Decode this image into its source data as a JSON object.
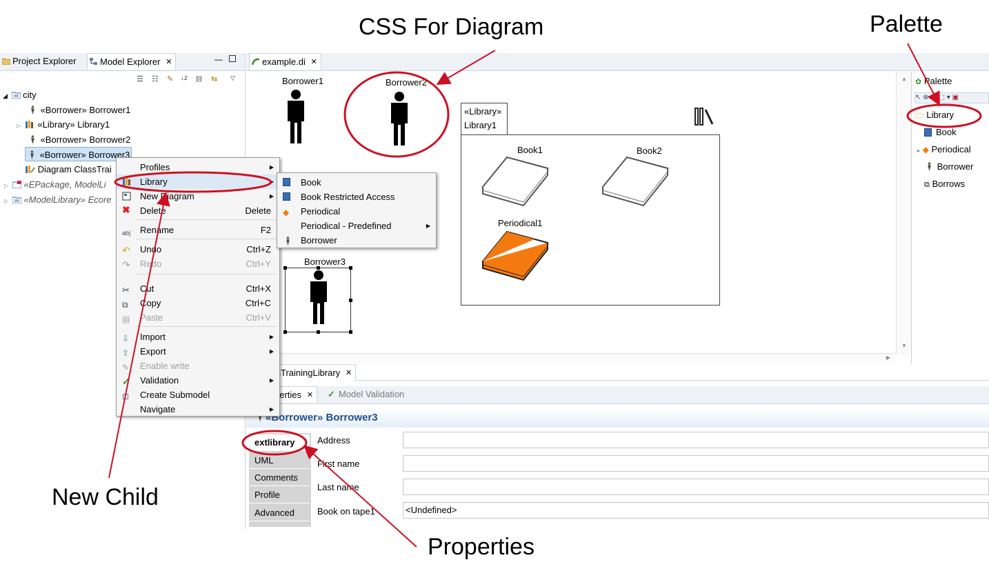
{
  "callouts": {
    "css_for_diagram": "CSS For Diagram",
    "palette": "Palette",
    "new_child": "New Child",
    "properties": "Properties"
  },
  "left_panel": {
    "tabs": [
      {
        "label": "Project Explorer"
      },
      {
        "label": "Model Explorer"
      }
    ],
    "tree": [
      {
        "label": "city"
      },
      {
        "label": "«Borrower» Borrower1"
      },
      {
        "label": "«Library» Library1"
      },
      {
        "label": "«Borrower» Borrower2"
      },
      {
        "label": "«Borrower» Borrower3"
      },
      {
        "label": "Diagram ClassTrai"
      },
      {
        "label": "«EPackage, ModelLi"
      },
      {
        "label": "«ModelLibrary» Ecore"
      }
    ]
  },
  "context_menu": {
    "items": [
      {
        "label": "Profiles",
        "shortcut": ""
      },
      {
        "label": "Library",
        "shortcut": ""
      },
      {
        "label": "New Diagram",
        "shortcut": ""
      },
      {
        "label": "Delete",
        "shortcut": "Delete"
      },
      {
        "label": "Rename",
        "shortcut": "F2"
      },
      {
        "label": "Undo",
        "shortcut": "Ctrl+Z"
      },
      {
        "label": "Redo",
        "shortcut": "Ctrl+Y"
      },
      {
        "label": "Cut",
        "shortcut": "Ctrl+X"
      },
      {
        "label": "Copy",
        "shortcut": "Ctrl+C"
      },
      {
        "label": "Paste",
        "shortcut": "Ctrl+V"
      },
      {
        "label": "Import",
        "shortcut": ""
      },
      {
        "label": "Export",
        "shortcut": ""
      },
      {
        "label": "Enable write",
        "shortcut": ""
      },
      {
        "label": "Validation",
        "shortcut": ""
      },
      {
        "label": "Create Submodel",
        "shortcut": ""
      },
      {
        "label": "Navigate",
        "shortcut": ""
      }
    ]
  },
  "submenu": {
    "items": [
      {
        "label": "Book"
      },
      {
        "label": "Book Restricted Access"
      },
      {
        "label": "Periodical"
      },
      {
        "label": "Periodical - Predefined"
      },
      {
        "label": "Borrower"
      }
    ]
  },
  "editor": {
    "tab_label": "example.di",
    "diagram": {
      "borrower1": "Borrower1",
      "borrower2": "Borrower2",
      "borrower3": "Borrower3",
      "library_stereotype": "«Library»",
      "library_name": "Library1",
      "book1": "Book1",
      "book2": "Book2",
      "periodical1": "Periodical1"
    },
    "bottom_tab": "ssTrainingLibrary"
  },
  "palette": {
    "title": "Palette",
    "items": [
      {
        "label": "Library"
      },
      {
        "label": "Book"
      },
      {
        "label": "Periodical"
      },
      {
        "label": "Borrower"
      },
      {
        "label": "Borrows"
      }
    ]
  },
  "properties": {
    "tabs": [
      {
        "label": "perties"
      },
      {
        "label": "Model Validation"
      }
    ],
    "heading": "«Borrower» Borrower3",
    "side_tabs": [
      {
        "label": "extlibrary"
      },
      {
        "label": "UML"
      },
      {
        "label": "Comments"
      },
      {
        "label": "Profile"
      },
      {
        "label": "Advanced"
      }
    ],
    "fields": [
      {
        "label": "Address",
        "value": ""
      },
      {
        "label": "First name",
        "value": ""
      },
      {
        "label": "Last name",
        "value": ""
      },
      {
        "label": "Book on tape1",
        "value": "<Undefined>"
      }
    ]
  },
  "colors": {
    "annotation_red": "#cc1122",
    "heading_blue": "#1f4e8c",
    "periodical_orange": "#f47a10"
  }
}
